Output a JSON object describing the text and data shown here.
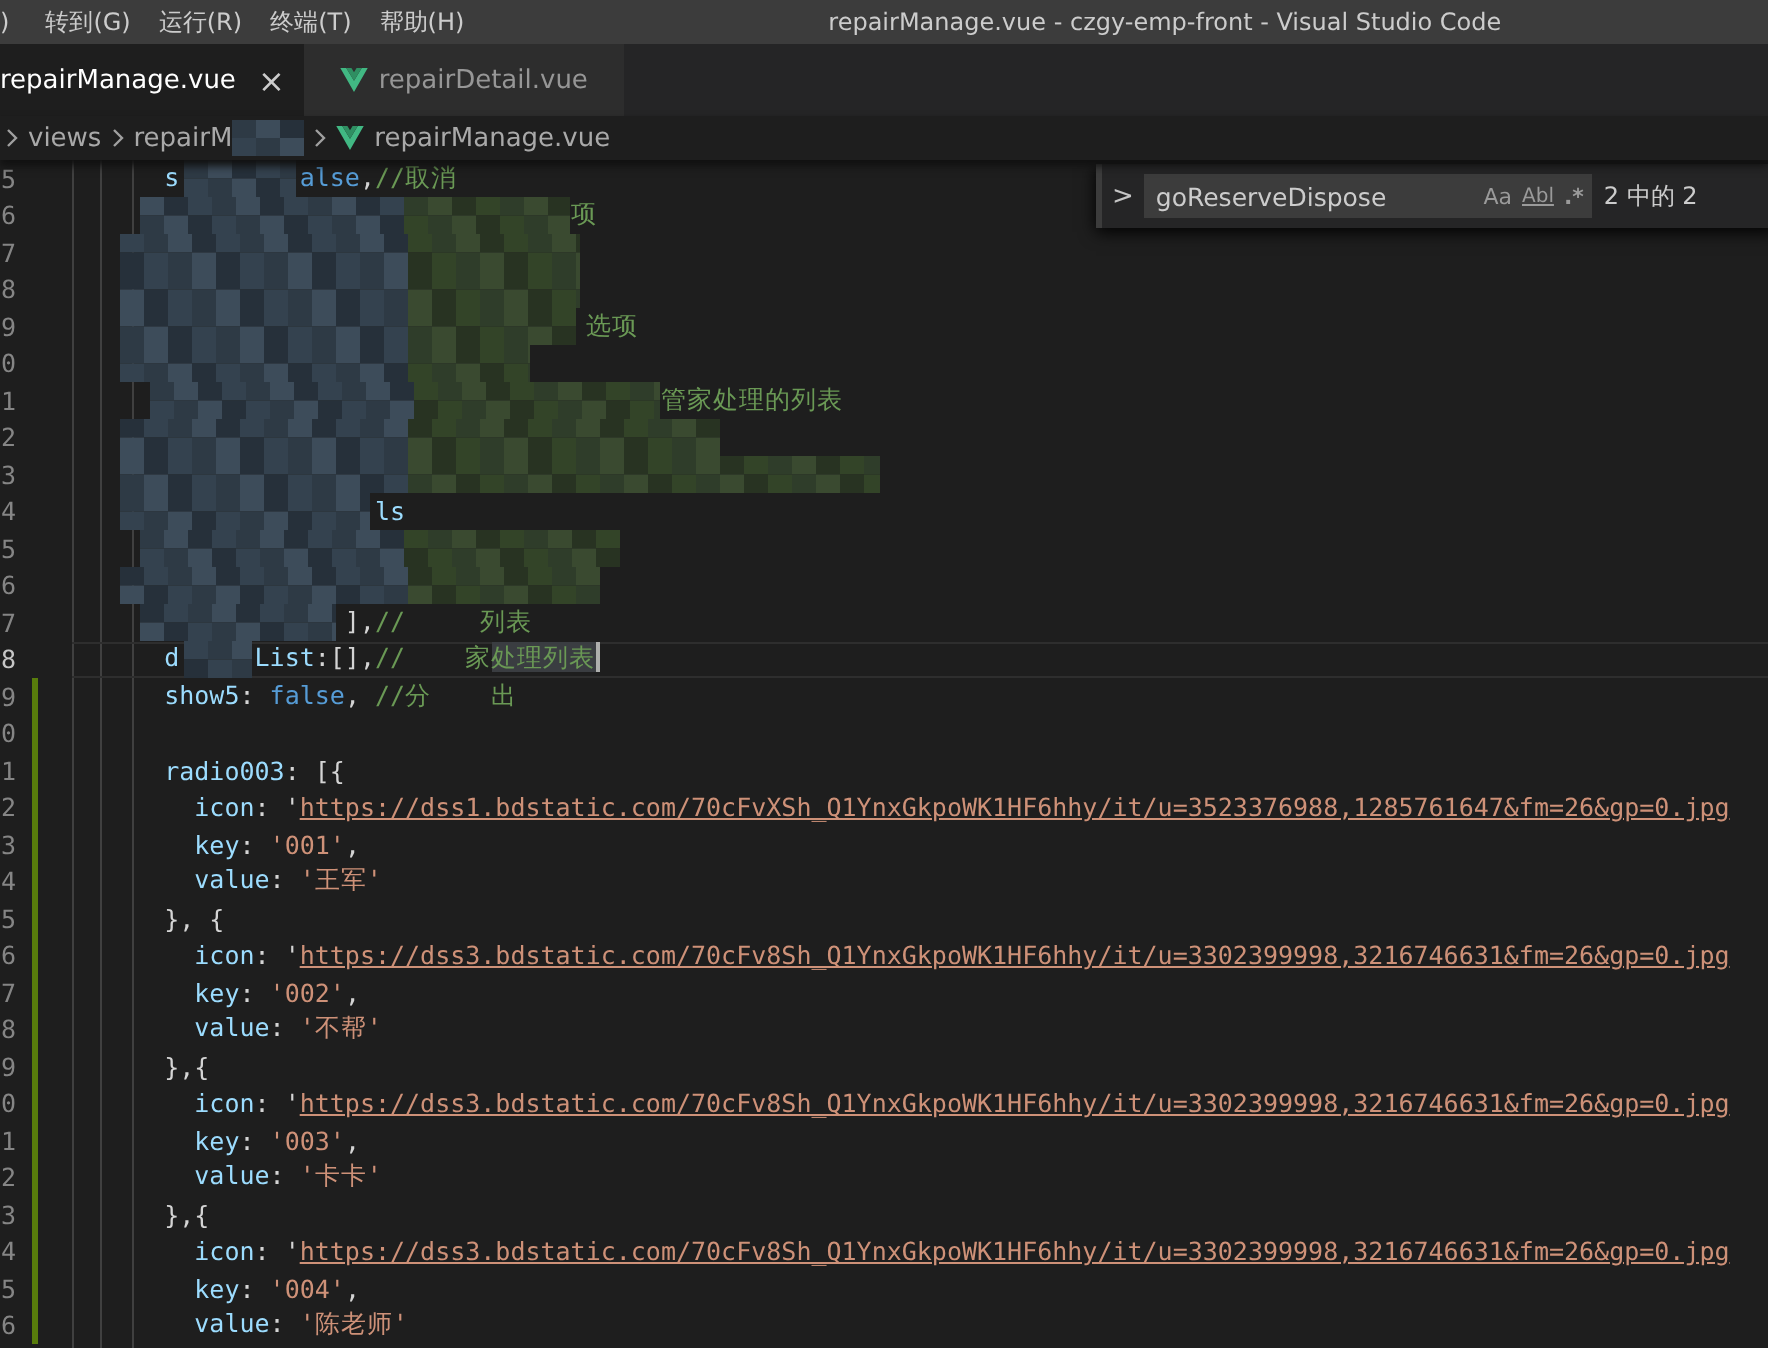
{
  "menu": [
    ")",
    "转到(G)",
    "运行(R)",
    "终端(T)",
    "帮助(H)"
  ],
  "window": {
    "title": "repairManage.vue - czgy-emp-front - Visual Studio Code"
  },
  "tabs": [
    {
      "label": "repairManage.vue",
      "selected": true,
      "close": "×"
    },
    {
      "label": "repairDetail.vue",
      "selected": false
    }
  ],
  "breadcrumb": [
    "views",
    "repairM",
    "repairManage.vue"
  ],
  "find": {
    "toggle": ">",
    "value": "goReserveDispose",
    "options": [
      "Aa",
      "Abl",
      ".*"
    ],
    "count": "2 中的 2"
  },
  "lines": [
    {
      "number": "5",
      "modified": false,
      "current": false,
      "segments": [
        {
          "text": "    s",
          "kind": "key"
        },
        {
          "text": "        alse",
          "kind": "keyword"
        },
        {
          "text": ",",
          "kind": "plain"
        },
        {
          "text": "//取消",
          "kind": "comment"
        }
      ]
    },
    {
      "number": "6",
      "modified": false,
      "current": false,
      "segments": [
        {
          "text": "                               项",
          "kind": "comment"
        }
      ]
    },
    {
      "number": "7",
      "modified": false,
      "current": false
    },
    {
      "number": "8",
      "modified": false,
      "current": false
    },
    {
      "number": "9",
      "modified": false,
      "current": false,
      "segments": [
        {
          "text": "                                选项",
          "kind": "comment"
        }
      ]
    },
    {
      "number": "0",
      "modified": false,
      "current": false
    },
    {
      "number": "1",
      "modified": false,
      "current": false,
      "segments": [
        {
          "text": "                                     管家处理的列表",
          "kind": "comment"
        }
      ]
    },
    {
      "number": "2",
      "modified": false,
      "current": false
    },
    {
      "number": "3",
      "modified": false,
      "current": false
    },
    {
      "number": "4",
      "modified": false,
      "current": false,
      "segments": [
        {
          "text": "                  ls",
          "kind": "key"
        }
      ]
    },
    {
      "number": "5",
      "modified": false,
      "current": false
    },
    {
      "number": "6",
      "modified": false,
      "current": false
    },
    {
      "number": "7",
      "modified": false,
      "current": false,
      "segments": [
        {
          "text": "                ],",
          "kind": "plain"
        },
        {
          "text": "//",
          "kind": "comment"
        },
        {
          "text": "     列表",
          "kind": "comment"
        }
      ]
    },
    {
      "number": "8",
      "modified": false,
      "current": true,
      "segments": [
        {
          "text": "    d",
          "kind": "key"
        },
        {
          "text": "     List",
          "kind": "key"
        },
        {
          "text": ":[],",
          "kind": "plain"
        },
        {
          "text": "//    家",
          "kind": "comment"
        },
        {
          "text": "处理列表",
          "kind": "selection"
        }
      ]
    },
    {
      "number": "9",
      "modified": true,
      "current": false,
      "segments": [
        {
          "text": "    show5",
          "kind": "key"
        },
        {
          "text": ": ",
          "kind": "plain"
        },
        {
          "text": "false",
          "kind": "keyword"
        },
        {
          "text": ", ",
          "kind": "plain"
        },
        {
          "text": "//分    出",
          "kind": "comment"
        }
      ]
    },
    {
      "number": "0",
      "modified": true,
      "current": false
    },
    {
      "number": "1",
      "modified": true,
      "current": false,
      "segments": [
        {
          "text": "    radio003",
          "kind": "key"
        },
        {
          "text": ": [{",
          "kind": "plain"
        }
      ]
    },
    {
      "number": "2",
      "modified": true,
      "current": false,
      "segments": [
        {
          "text": "      icon",
          "kind": "key"
        },
        {
          "text": ": '",
          "kind": "plain"
        },
        {
          "text": "https://dss1.bdstatic.com/70cFvXSh_Q1YnxGkpoWK1HF6hhy/it/u=3523376988,1285761647&fm=26&gp=0.jpg",
          "kind": "link"
        }
      ]
    },
    {
      "number": "3",
      "modified": true,
      "current": false,
      "segments": [
        {
          "text": "      key",
          "kind": "key"
        },
        {
          "text": ": ",
          "kind": "plain"
        },
        {
          "text": "'001'",
          "kind": "string"
        },
        {
          "text": ",",
          "kind": "plain"
        }
      ]
    },
    {
      "number": "4",
      "modified": true,
      "current": false,
      "segments": [
        {
          "text": "      value",
          "kind": "key"
        },
        {
          "text": ": ",
          "kind": "plain"
        },
        {
          "text": "'王军'",
          "kind": "string"
        }
      ]
    },
    {
      "number": "5",
      "modified": true,
      "current": false,
      "segments": [
        {
          "text": "    }, {",
          "kind": "plain"
        }
      ]
    },
    {
      "number": "6",
      "modified": true,
      "current": false,
      "segments": [
        {
          "text": "      icon",
          "kind": "key"
        },
        {
          "text": ": '",
          "kind": "plain"
        },
        {
          "text": "https://dss3.bdstatic.com/70cFv8Sh_Q1YnxGkpoWK1HF6hhy/it/u=3302399998,3216746631&fm=26&gp=0.jpg",
          "kind": "link"
        }
      ]
    },
    {
      "number": "7",
      "modified": true,
      "current": false,
      "segments": [
        {
          "text": "      key",
          "kind": "key"
        },
        {
          "text": ": ",
          "kind": "plain"
        },
        {
          "text": "'002'",
          "kind": "string"
        },
        {
          "text": ",",
          "kind": "plain"
        }
      ]
    },
    {
      "number": "8",
      "modified": true,
      "current": false,
      "segments": [
        {
          "text": "      value",
          "kind": "key"
        },
        {
          "text": ": ",
          "kind": "plain"
        },
        {
          "text": "'不帮'",
          "kind": "string"
        }
      ]
    },
    {
      "number": "9",
      "modified": true,
      "current": false,
      "segments": [
        {
          "text": "    },{",
          "kind": "plain"
        }
      ]
    },
    {
      "number": "0",
      "modified": true,
      "current": false,
      "segments": [
        {
          "text": "      icon",
          "kind": "key"
        },
        {
          "text": ": '",
          "kind": "plain"
        },
        {
          "text": "https://dss3.bdstatic.com/70cFv8Sh_Q1YnxGkpoWK1HF6hhy/it/u=3302399998,3216746631&fm=26&gp=0.jpg",
          "kind": "link"
        }
      ]
    },
    {
      "number": "1",
      "modified": true,
      "current": false,
      "segments": [
        {
          "text": "      key",
          "kind": "key"
        },
        {
          "text": ": ",
          "kind": "plain"
        },
        {
          "text": "'003'",
          "kind": "string"
        },
        {
          "text": ",",
          "kind": "plain"
        }
      ]
    },
    {
      "number": "2",
      "modified": true,
      "current": false,
      "segments": [
        {
          "text": "      value",
          "kind": "key"
        },
        {
          "text": ": ",
          "kind": "plain"
        },
        {
          "text": "'卡卡'",
          "kind": "string"
        }
      ]
    },
    {
      "number": "3",
      "modified": true,
      "current": false,
      "segments": [
        {
          "text": "    },{",
          "kind": "plain"
        }
      ]
    },
    {
      "number": "4",
      "modified": true,
      "current": false,
      "segments": [
        {
          "text": "      icon",
          "kind": "key"
        },
        {
          "text": ": '",
          "kind": "plain"
        },
        {
          "text": "https://dss3.bdstatic.com/70cFv8Sh_Q1YnxGkpoWK1HF6hhy/it/u=3302399998,3216746631&fm=26&gp=0.jpg",
          "kind": "link"
        }
      ]
    },
    {
      "number": "5",
      "modified": true,
      "current": false,
      "segments": [
        {
          "text": "      key",
          "kind": "key"
        },
        {
          "text": ": ",
          "kind": "plain"
        },
        {
          "text": "'004'",
          "kind": "string"
        },
        {
          "text": ",",
          "kind": "plain"
        }
      ]
    },
    {
      "number": "6",
      "modified": true,
      "current": false,
      "segments": [
        {
          "text": "      value",
          "kind": "key"
        },
        {
          "text": ": ",
          "kind": "plain"
        },
        {
          "text": "'陈老师'",
          "kind": "string"
        }
      ]
    }
  ]
}
